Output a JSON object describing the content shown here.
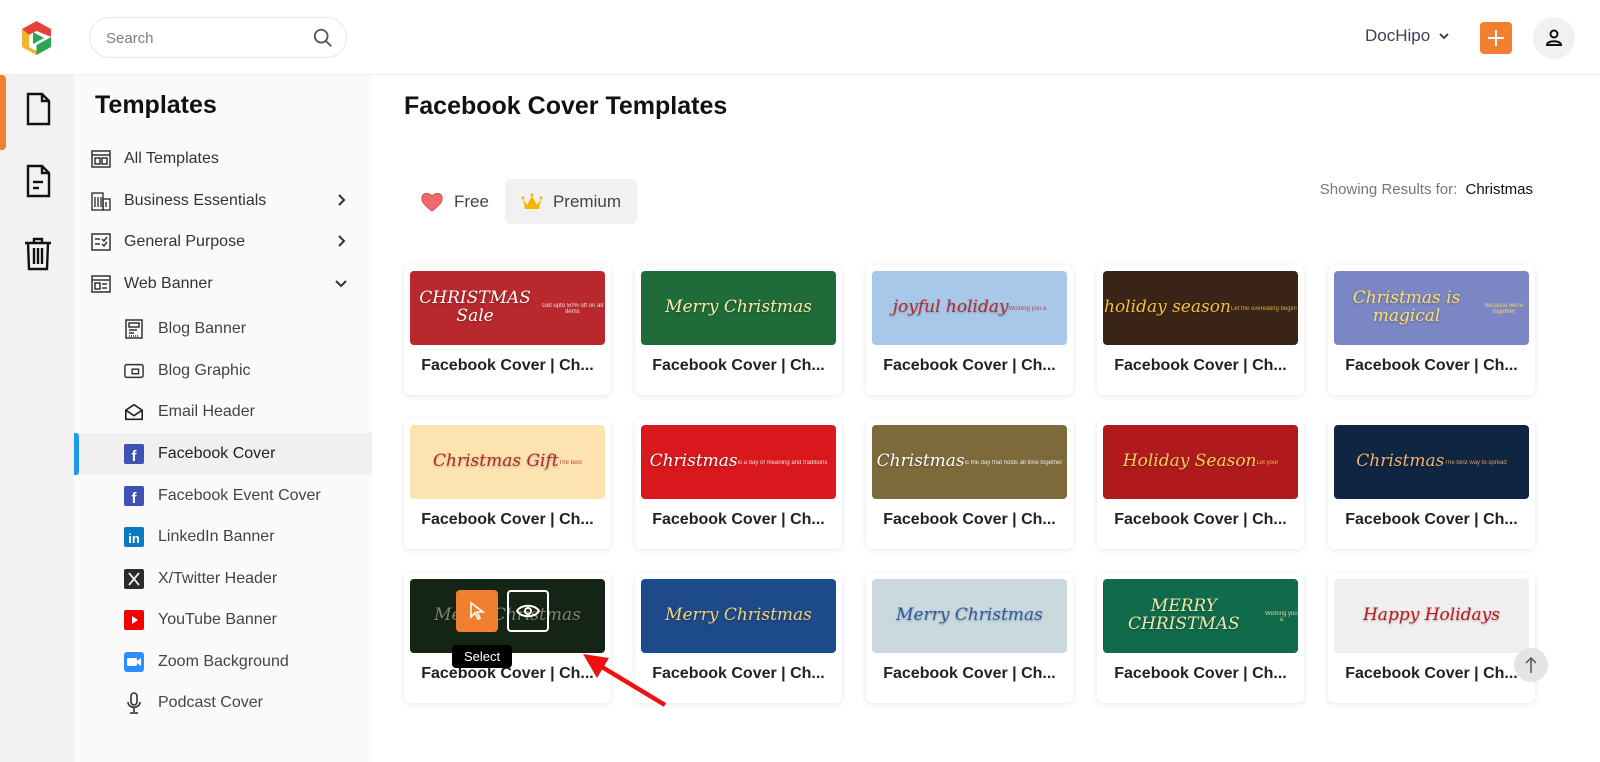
{
  "header": {
    "search_placeholder": "Search",
    "workspace_label": "DocHipo",
    "add_label": "+",
    "accent_color": "#f08030"
  },
  "rail": {
    "items": [
      {
        "icon": "file-icon",
        "label": "Templates",
        "active": true
      },
      {
        "icon": "document-icon",
        "label": "Documents",
        "active": false
      },
      {
        "icon": "trash-icon",
        "label": "Trash",
        "active": false
      }
    ]
  },
  "sidebar": {
    "title": "Templates",
    "categories": [
      {
        "label": "All Templates",
        "icon": "all-templates-icon",
        "expandable": false
      },
      {
        "label": "Business Essentials",
        "icon": "building-icon",
        "expandable": true,
        "expanded": false
      },
      {
        "label": "General Purpose",
        "icon": "checklist-icon",
        "expandable": true,
        "expanded": false
      },
      {
        "label": "Web Banner",
        "icon": "web-banner-icon",
        "expandable": true,
        "expanded": true
      }
    ],
    "subitems": [
      {
        "label": "Blog Banner",
        "icon": "blog-banner-icon"
      },
      {
        "label": "Blog Graphic",
        "icon": "blog-graphic-icon"
      },
      {
        "label": "Email Header",
        "icon": "email-icon"
      },
      {
        "label": "Facebook Cover",
        "icon": "facebook-icon",
        "active": true
      },
      {
        "label": "Facebook Event Cover",
        "icon": "facebook-icon"
      },
      {
        "label": "LinkedIn Banner",
        "icon": "linkedin-icon"
      },
      {
        "label": "X/Twitter Header",
        "icon": "x-twitter-icon"
      },
      {
        "label": "YouTube Banner",
        "icon": "youtube-icon"
      },
      {
        "label": "Zoom Background",
        "icon": "zoom-video-icon"
      },
      {
        "label": "Podcast Cover",
        "icon": "microphone-icon"
      }
    ]
  },
  "main": {
    "title": "Facebook Cover Templates",
    "tabs": [
      {
        "label": "Free",
        "icon": "heart-icon",
        "active": false
      },
      {
        "label": "Premium",
        "icon": "crown-icon",
        "active": true
      }
    ],
    "results_label": "Showing Results for:",
    "results_term": "Christmas",
    "hover_actions": {
      "select_tooltip": "Select"
    },
    "templates": [
      {
        "name": "Facebook Cover | Ch...",
        "thumb_text": "CHRISTMAS Sale",
        "thumb_sub": "Get upto 50% off on all items",
        "bg": "#b8282c",
        "fg": "#ffffff"
      },
      {
        "name": "Facebook Cover | Ch...",
        "thumb_text": "Merry Christmas",
        "thumb_sub": "",
        "bg": "#1f6b3a",
        "fg": "#ffe9a8"
      },
      {
        "name": "Facebook Cover | Ch...",
        "thumb_text": "joyful holiday",
        "thumb_sub": "Wishing you a",
        "bg": "#a8c8ea",
        "fg": "#b22a2a"
      },
      {
        "name": "Facebook Cover | Ch...",
        "thumb_text": "holiday season",
        "thumb_sub": "Let the overeating begin!",
        "bg": "#3a2418",
        "fg": "#f2c13b"
      },
      {
        "name": "Facebook Cover | Ch...",
        "thumb_text": "Christmas is magical",
        "thumb_sub": "because we're together",
        "bg": "#7b86c4",
        "fg": "#ffe066"
      },
      {
        "name": "Facebook Cover | Ch...",
        "thumb_text": "Christmas Gift",
        "thumb_sub": "The best",
        "bg": "#fde3b0",
        "fg": "#b3282d"
      },
      {
        "name": "Facebook Cover | Ch...",
        "thumb_text": "Christmas",
        "thumb_sub": "is a day of meaning and traditions",
        "bg": "#d8181c",
        "fg": "#ffffff"
      },
      {
        "name": "Facebook Cover | Ch...",
        "thumb_text": "Christmas",
        "thumb_sub": "is the day that holds all time together",
        "bg": "#7c6a3a",
        "fg": "#ffffff"
      },
      {
        "name": "Facebook Cover | Ch...",
        "thumb_text": "Holiday Season",
        "thumb_sub": "Let your",
        "bg": "#b11a1d",
        "fg": "#f7cf5a"
      },
      {
        "name": "Facebook Cover | Ch...",
        "thumb_text": "Christmas",
        "thumb_sub": "The best way to spread",
        "bg": "#0f2541",
        "fg": "#f3b36a"
      },
      {
        "name": "Facebook Cover | Ch...",
        "thumb_text": "Merry Christmas",
        "thumb_sub": "",
        "bg": "#1f3a22",
        "fg": "#c9c9a8",
        "hovered": true
      },
      {
        "name": "Facebook Cover | Ch...",
        "thumb_text": "Merry Christmas",
        "thumb_sub": "",
        "bg": "#1d4a8a",
        "fg": "#f4d27a"
      },
      {
        "name": "Facebook Cover | Ch...",
        "thumb_text": "Merry Christmas",
        "thumb_sub": "",
        "bg": "#c9d9de",
        "fg": "#2c5aa0"
      },
      {
        "name": "Facebook Cover | Ch...",
        "thumb_text": "MERRY CHRISTMAS",
        "thumb_sub": "Wishing you a",
        "bg": "#0f6b4b",
        "fg": "#f5e6b0"
      },
      {
        "name": "Facebook Cover | Ch...",
        "thumb_text": "Happy Holidays",
        "thumb_sub": "",
        "bg": "#efefef",
        "fg": "#c0161c"
      }
    ]
  }
}
